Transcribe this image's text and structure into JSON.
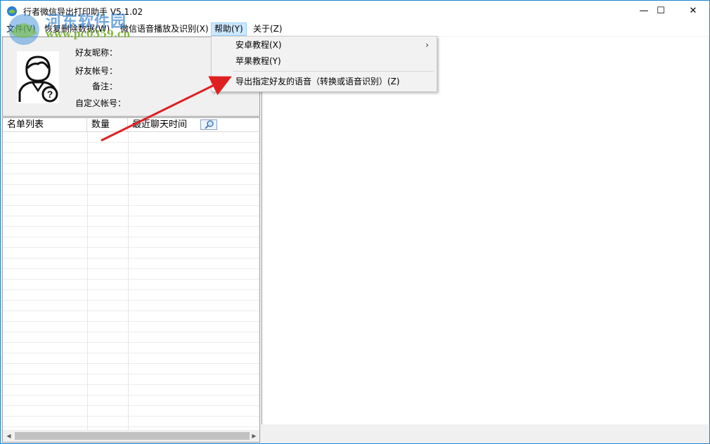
{
  "window": {
    "title": "行者微信导出打印助手  V5.1.02",
    "minimize_glyph": "—",
    "maximize_glyph": "☐",
    "close_glyph": "✕"
  },
  "menubar": {
    "items": [
      {
        "label": "文件(V)"
      },
      {
        "label": "恢复删除数据(W)"
      },
      {
        "label": "微信语音播放及识别(X)"
      },
      {
        "label": "帮助(Y)"
      },
      {
        "label": "关于(Z)"
      }
    ]
  },
  "watermark": {
    "line1": "河东软件园",
    "line2": "www.pc0359.cn"
  },
  "profile": {
    "nickname_label": "好友昵称：",
    "account_label": "好友帐号：",
    "remark_label": "备注：",
    "custom_account_label": "自定义帐号："
  },
  "list": {
    "columns": [
      "名单列表",
      "数量",
      "最近聊天时间"
    ],
    "rows": []
  },
  "help_menu": {
    "items": [
      {
        "label": "安卓教程(X)",
        "has_submenu": true
      },
      {
        "label": "苹果教程(Y)",
        "has_submenu": false
      },
      {
        "label": "导出指定好友的语音（转换或语音识别）(Z)",
        "has_submenu": false
      }
    ],
    "submenu_arrow": "›"
  },
  "colors": {
    "window_border": "#1883d7",
    "menu_active_bg": "#cce8ff",
    "annotation_arrow": "#e02020"
  }
}
